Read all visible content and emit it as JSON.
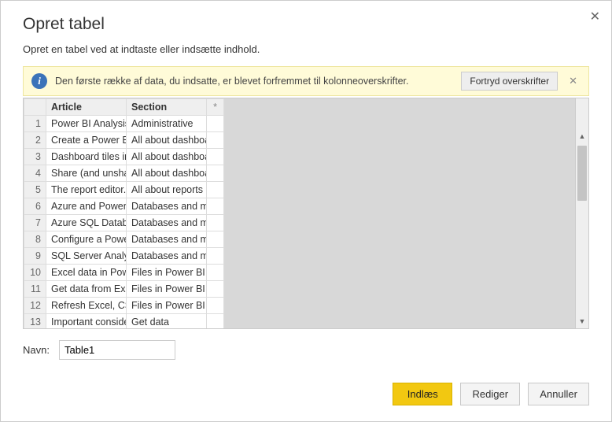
{
  "dialog": {
    "title": "Opret tabel",
    "subtitle": "Opret en tabel ved at indtaste eller indsætte indhold."
  },
  "notice": {
    "text": "Den første række af data, du indsatte, er blevet forfremmet til kolonneoverskrifter.",
    "undo_label": "Fortryd overskrifter"
  },
  "grid": {
    "headers": {
      "article": "Article",
      "section": "Section",
      "star": "*"
    },
    "rows": [
      {
        "n": "1",
        "article": "Power BI Analysis",
        "section": "Administrative"
      },
      {
        "n": "2",
        "article": "Create a Power BI",
        "section": "All about dashboa"
      },
      {
        "n": "3",
        "article": "Dashboard tiles in",
        "section": "All about dashboa"
      },
      {
        "n": "4",
        "article": "Share (and unshar",
        "section": "All about dashboa"
      },
      {
        "n": "5",
        "article": "The report editor..",
        "section": "All about reports"
      },
      {
        "n": "6",
        "article": "Azure and Power B",
        "section": "Databases and mo"
      },
      {
        "n": "7",
        "article": "Azure SQL Databa",
        "section": "Databases and mo"
      },
      {
        "n": "8",
        "article": "Configure a Power",
        "section": "Databases and mo"
      },
      {
        "n": "9",
        "article": "SQL Server Analys",
        "section": "Databases and mo"
      },
      {
        "n": "10",
        "article": "Excel data in Powe",
        "section": "Files in Power BI"
      },
      {
        "n": "11",
        "article": "Get data from Exc",
        "section": "Files in Power BI"
      },
      {
        "n": "12",
        "article": "Refresh Excel, CSV",
        "section": "Files in Power BI"
      },
      {
        "n": "13",
        "article": "Important conside",
        "section": "Get data"
      }
    ]
  },
  "name": {
    "label": "Navn:",
    "value": "Table1"
  },
  "buttons": {
    "load": "Indlæs",
    "edit": "Rediger",
    "cancel": "Annuller"
  }
}
